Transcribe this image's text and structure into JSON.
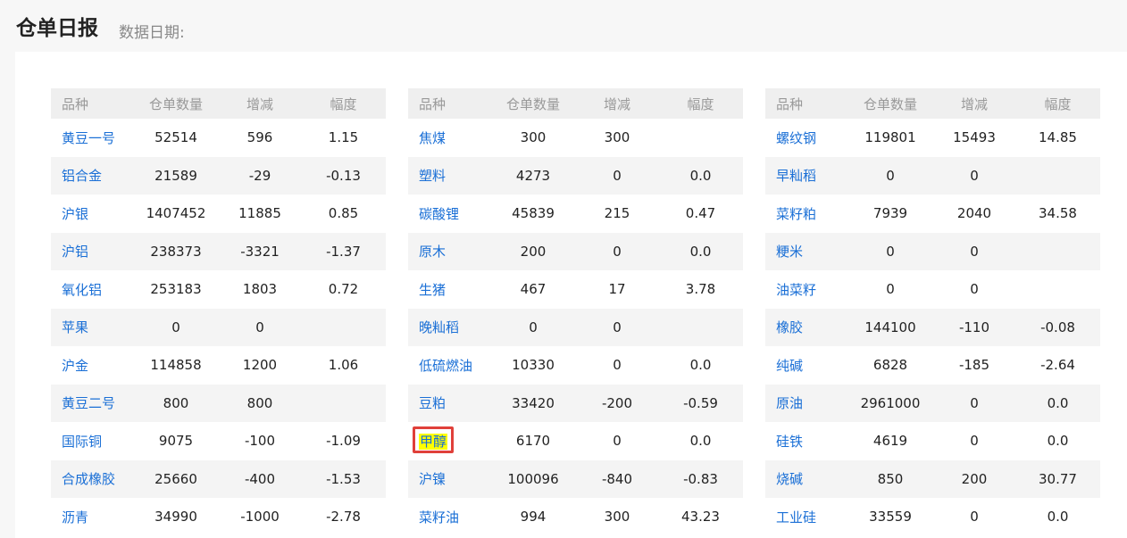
{
  "header": {
    "title": "仓单日报",
    "date_label": "数据日期:"
  },
  "columns": [
    "品种",
    "仓单数量",
    "增减",
    "幅度"
  ],
  "colors": {
    "link": "#1a6fd6",
    "up": "#e5363d",
    "down": "#13a66e",
    "highlight": "#ffff00",
    "highlight_border": "#e0403a"
  },
  "tables": [
    {
      "rows": [
        {
          "name": "黄豆一号",
          "qty": "52514",
          "chg": "596",
          "pct": "1.15"
        },
        {
          "name": "铝合金",
          "qty": "21589",
          "chg": "-29",
          "pct": "-0.13"
        },
        {
          "name": "沪银",
          "qty": "1407452",
          "chg": "11885",
          "pct": "0.85"
        },
        {
          "name": "沪铝",
          "qty": "238373",
          "chg": "-3321",
          "pct": "-1.37"
        },
        {
          "name": "氧化铝",
          "qty": "253183",
          "chg": "1803",
          "pct": "0.72"
        },
        {
          "name": "苹果",
          "qty": "0",
          "chg": "0",
          "pct": ""
        },
        {
          "name": "沪金",
          "qty": "114858",
          "chg": "1200",
          "pct": "1.06"
        },
        {
          "name": "黄豆二号",
          "qty": "800",
          "chg": "800",
          "pct": ""
        },
        {
          "name": "国际铜",
          "qty": "9075",
          "chg": "-100",
          "pct": "-1.09"
        },
        {
          "name": "合成橡胶",
          "qty": "25660",
          "chg": "-400",
          "pct": "-1.53"
        },
        {
          "name": "沥青",
          "qty": "34990",
          "chg": "-1000",
          "pct": "-2.78"
        }
      ]
    },
    {
      "rows": [
        {
          "name": "焦煤",
          "qty": "300",
          "chg": "300",
          "pct": ""
        },
        {
          "name": "塑料",
          "qty": "4273",
          "chg": "0",
          "pct": "0.0"
        },
        {
          "name": "碳酸锂",
          "qty": "45839",
          "chg": "215",
          "pct": "0.47"
        },
        {
          "name": "原木",
          "qty": "200",
          "chg": "0",
          "pct": "0.0"
        },
        {
          "name": "生猪",
          "qty": "467",
          "chg": "17",
          "pct": "3.78"
        },
        {
          "name": "晚籼稻",
          "qty": "0",
          "chg": "0",
          "pct": ""
        },
        {
          "name": "低硫燃油",
          "qty": "10330",
          "chg": "0",
          "pct": "0.0"
        },
        {
          "name": "豆粕",
          "qty": "33420",
          "chg": "-200",
          "pct": "-0.59"
        },
        {
          "name": "甲醇",
          "qty": "6170",
          "chg": "0",
          "pct": "0.0",
          "highlighted": true
        },
        {
          "name": "沪镍",
          "qty": "100096",
          "chg": "-840",
          "pct": "-0.83"
        },
        {
          "name": "菜籽油",
          "qty": "994",
          "chg": "300",
          "pct": "43.23"
        }
      ]
    },
    {
      "rows": [
        {
          "name": "螺纹钢",
          "qty": "119801",
          "chg": "15493",
          "pct": "14.85"
        },
        {
          "name": "早籼稻",
          "qty": "0",
          "chg": "0",
          "pct": ""
        },
        {
          "name": "菜籽粕",
          "qty": "7939",
          "chg": "2040",
          "pct": "34.58"
        },
        {
          "name": "粳米",
          "qty": "0",
          "chg": "0",
          "pct": ""
        },
        {
          "name": "油菜籽",
          "qty": "0",
          "chg": "0",
          "pct": ""
        },
        {
          "name": "橡胶",
          "qty": "144100",
          "chg": "-110",
          "pct": "-0.08"
        },
        {
          "name": "纯碱",
          "qty": "6828",
          "chg": "-185",
          "pct": "-2.64"
        },
        {
          "name": "原油",
          "qty": "2961000",
          "chg": "0",
          "pct": "0.0"
        },
        {
          "name": "硅铁",
          "qty": "4619",
          "chg": "0",
          "pct": "0.0"
        },
        {
          "name": "烧碱",
          "qty": "850",
          "chg": "200",
          "pct": "30.77"
        },
        {
          "name": "工业硅",
          "qty": "33559",
          "chg": "0",
          "pct": "0.0"
        }
      ]
    }
  ]
}
